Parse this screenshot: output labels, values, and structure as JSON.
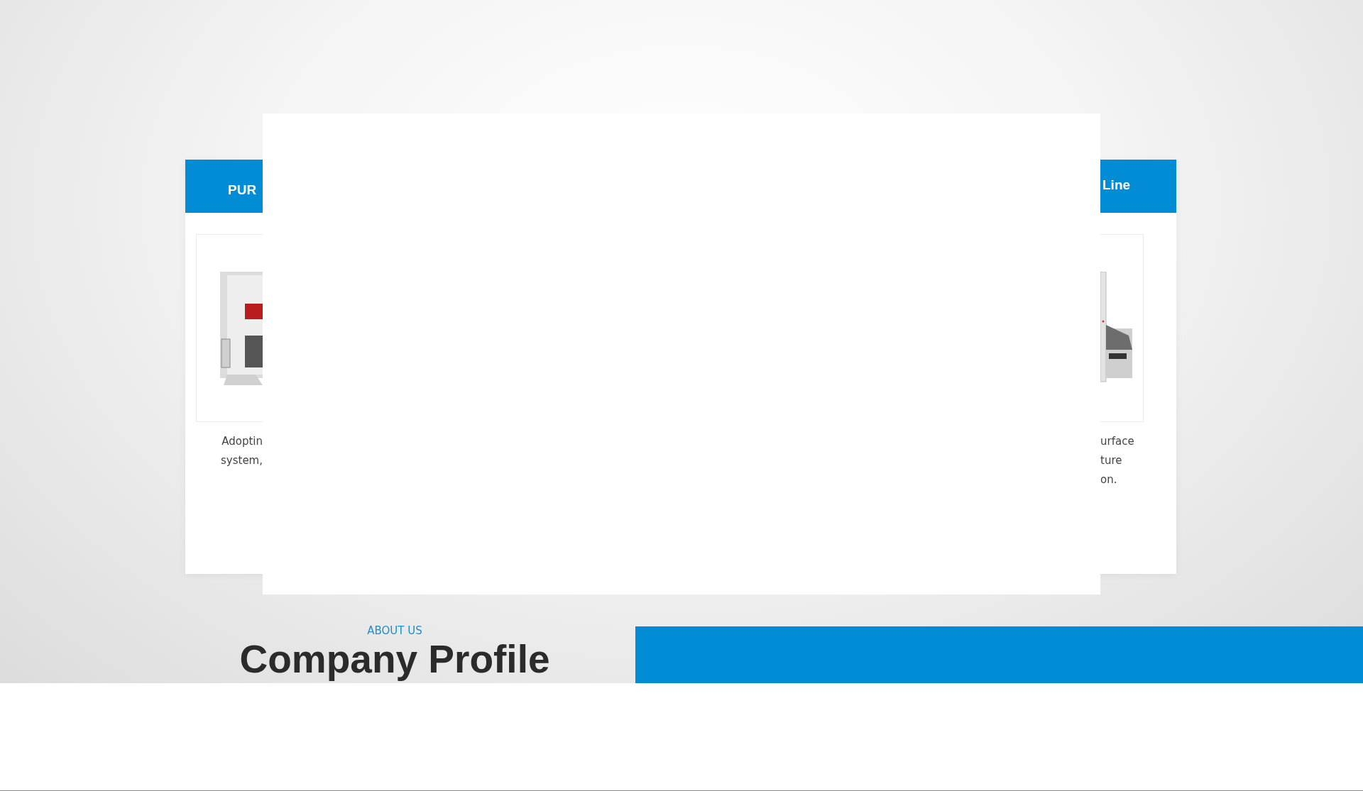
{
  "product_cards": [
    {
      "title": "PUR",
      "description_lines": [
        "Adoptin",
        "system,"
      ]
    },
    {
      "title": "Line",
      "description_lines": [
        "urface",
        "ture",
        "on."
      ]
    }
  ],
  "about": {
    "eyebrow": "ABOUT US",
    "heading": "Company Profile"
  }
}
